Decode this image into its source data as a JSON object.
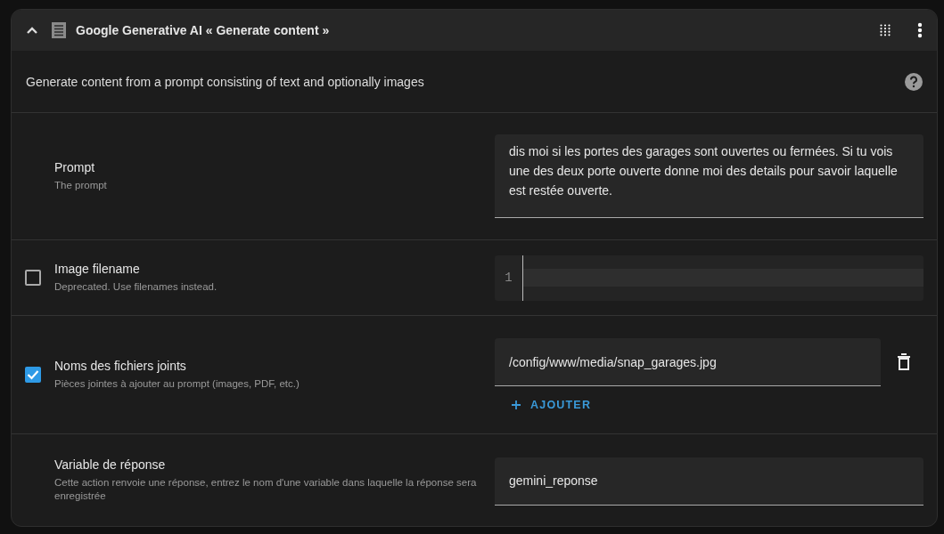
{
  "header": {
    "title": "Google Generative AI « Generate content »",
    "expanded": true
  },
  "description": "Generate content from a prompt consisting of text and optionally images",
  "rows": [
    {
      "kind": "textarea",
      "label": "Prompt",
      "helper": "The prompt",
      "value": "dis moi si les portes des garages sont ouvertes ou fermées. Si tu vois une des deux porte ouverte donne moi des details pour savoir laquelle est restée ouverte."
    },
    {
      "kind": "code",
      "label": "Image filename",
      "helper": "Deprecated. Use filenames instead.",
      "checked": false,
      "line_number": "1"
    },
    {
      "kind": "list",
      "label": "Noms des fichiers joints",
      "helper": "Pièces jointes à ajouter au prompt (images, PDF, etc.)",
      "checked": true,
      "items": [
        "/config/www/media/snap_garages.jpg"
      ],
      "add_label": "AJOUTER"
    },
    {
      "kind": "text",
      "label": "Variable de réponse",
      "helper": "Cette action renvoie une réponse, entrez le nom d'une variable dans laquelle la réponse sera enregistrée",
      "value": "gemini_reponse"
    }
  ]
}
